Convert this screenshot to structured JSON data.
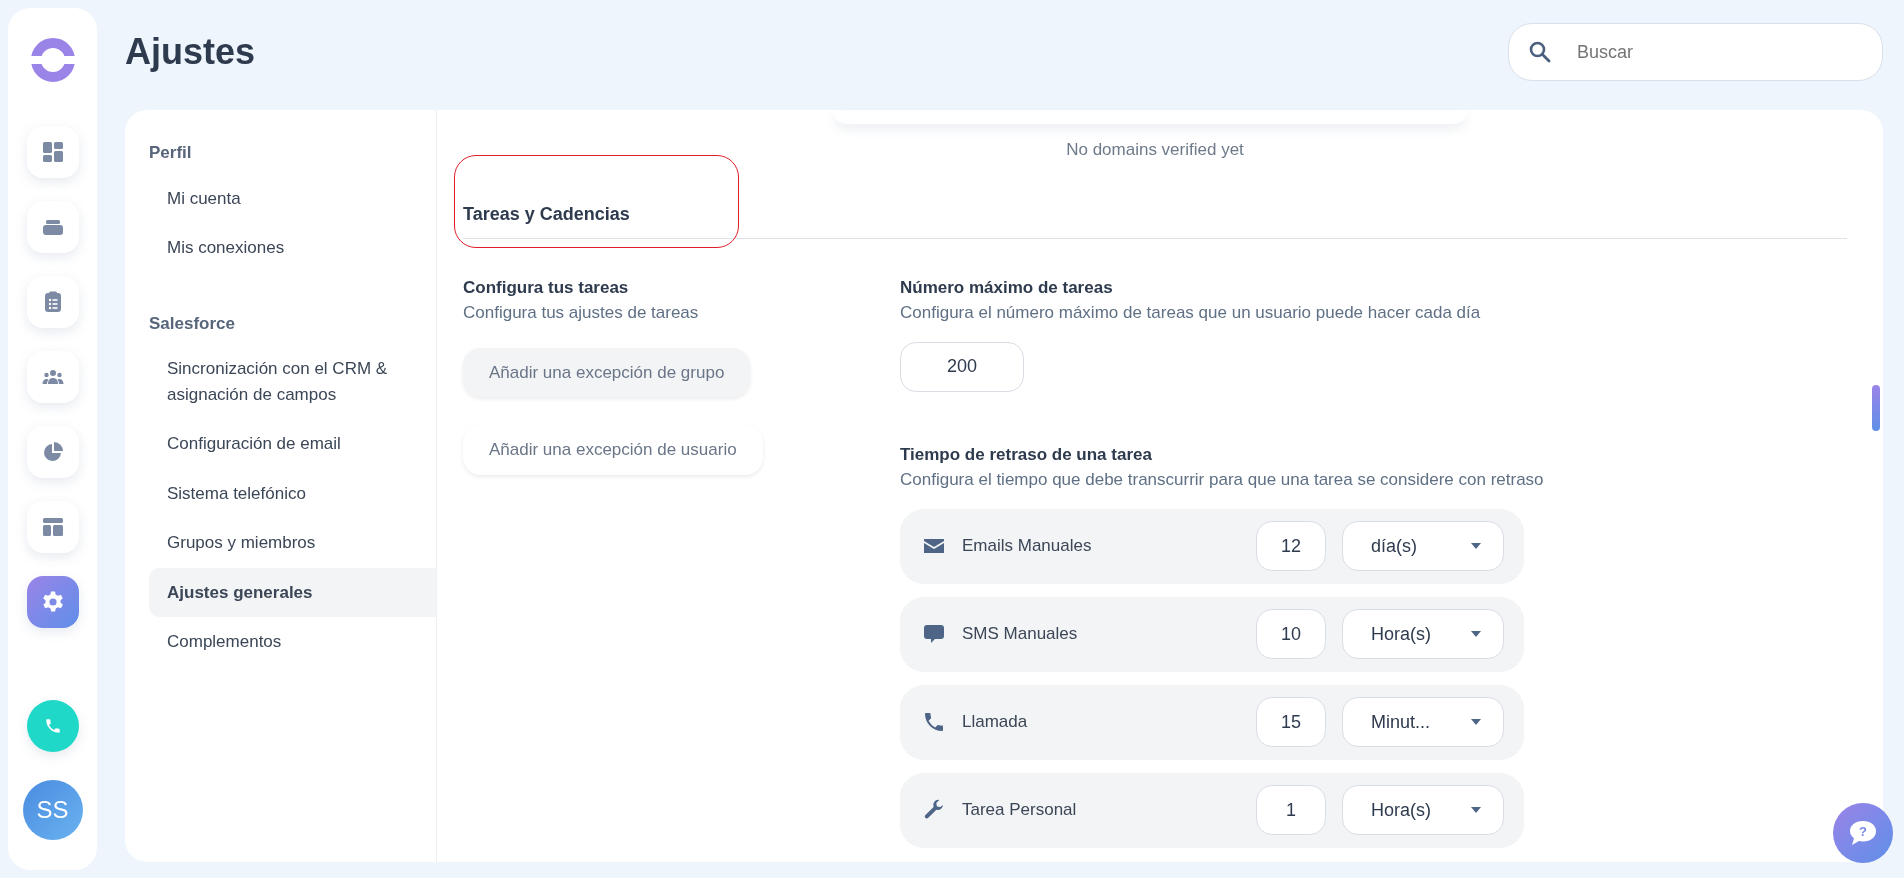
{
  "rail": {
    "items": [
      {
        "kind": "dashboard",
        "selected": false
      },
      {
        "kind": "inbox",
        "selected": false
      },
      {
        "kind": "tasks",
        "selected": false
      },
      {
        "kind": "people",
        "selected": false
      },
      {
        "kind": "reports",
        "selected": false
      },
      {
        "kind": "layout",
        "selected": false
      },
      {
        "kind": "settings",
        "selected": true
      }
    ],
    "avatar": "SS"
  },
  "page_title": "Ajustes",
  "help": {
    "label": "?"
  },
  "search": {
    "placeholder": "Buscar"
  },
  "menu": [
    {
      "heading": "Perfil",
      "items": [
        {
          "label": "Mi cuenta",
          "selected": false
        },
        {
          "label": "Mis conexiones",
          "selected": false
        }
      ]
    },
    {
      "heading": "Salesforce",
      "items": [
        {
          "label": "Sincronización con el CRM & asignación de campos",
          "selected": false
        },
        {
          "label": "Configuración de email",
          "selected": false
        },
        {
          "label": "Sistema telefónico",
          "selected": false
        },
        {
          "label": "Grupos y miembros",
          "selected": false
        },
        {
          "label": "Ajustes generales",
          "selected": true
        },
        {
          "label": "Complementos",
          "selected": false
        }
      ]
    }
  ],
  "domains_note": "No domains verified yet",
  "section": {
    "title": "Tareas y Cadencias",
    "highlighted": true
  },
  "configure": {
    "title": "Configura tus tareas",
    "subtitle": "Configura tus ajustes de tareas",
    "buttons": [
      {
        "label": "Añadir una excepción de grupo",
        "selected": true
      },
      {
        "label": "Añadir una excepción de usuario",
        "selected": false
      }
    ]
  },
  "max_tasks": {
    "title": "Número máximo de tareas",
    "subtitle": "Configura el número máximo de tareas que un usuario puede hacer cada día",
    "value": "200"
  },
  "delay": {
    "title": "Tiempo de retraso de una tarea",
    "subtitle": "Configura el tiempo que debe transcurrir para que una tarea se considere con retraso",
    "rows": [
      {
        "kind": "email",
        "label": "Emails Manuales",
        "amount": "12",
        "unit": "día(s)"
      },
      {
        "kind": "sms",
        "label": "SMS Manuales",
        "amount": "10",
        "unit": "Hora(s)"
      },
      {
        "kind": "call",
        "label": "Llamada",
        "amount": "15",
        "unit": "Minut..."
      },
      {
        "kind": "personal",
        "label": "Tarea Personal",
        "amount": "1",
        "unit": "Hora(s)"
      }
    ]
  }
}
